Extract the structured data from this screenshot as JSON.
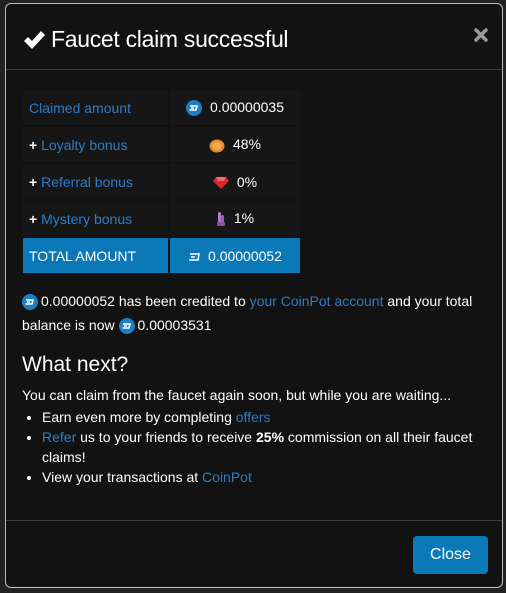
{
  "modal": {
    "title": "Faucet claim successful",
    "icons": {
      "title": "checkmark-icon",
      "close": "close-icon"
    }
  },
  "claim_table": {
    "rows": [
      {
        "label": "Claimed amount",
        "prefix": "",
        "icon": "dash-coin-icon",
        "value": "0.00000035"
      },
      {
        "label": "Loyalty bonus",
        "prefix": "+",
        "icon": "coin-icon",
        "value": "48%"
      },
      {
        "label": "Referral bonus",
        "prefix": "+",
        "icon": "ruby-icon",
        "value": "0%"
      },
      {
        "label": "Mystery bonus",
        "prefix": "+",
        "icon": "crystal-icon",
        "value": "1%"
      }
    ],
    "total": {
      "label": "TOTAL AMOUNT",
      "icon": "dash-icon",
      "value": "0.00000052"
    }
  },
  "credit": {
    "amount": "0.00000052",
    "text_before_link": "has been credited to",
    "link": "your CoinPot account",
    "text_after_link": "and your total balance is now",
    "balance": "0.00003531"
  },
  "what_next": {
    "heading": "What next?",
    "intro": "You can claim from the faucet again soon, but while you are waiting...",
    "items": [
      {
        "text": "Earn even more by completing",
        "link": "offers"
      },
      {
        "link": "Refer",
        "text": "us to your friends to receive",
        "bold": "25%",
        "text2": "commission on all their faucet claims!"
      },
      {
        "text": "View your transactions at",
        "link": "CoinPot"
      }
    ]
  },
  "footer": {
    "close_label": "Close"
  },
  "colors": {
    "accent": "#0b78b8",
    "link": "#2d7dc4",
    "background": "#121212"
  }
}
